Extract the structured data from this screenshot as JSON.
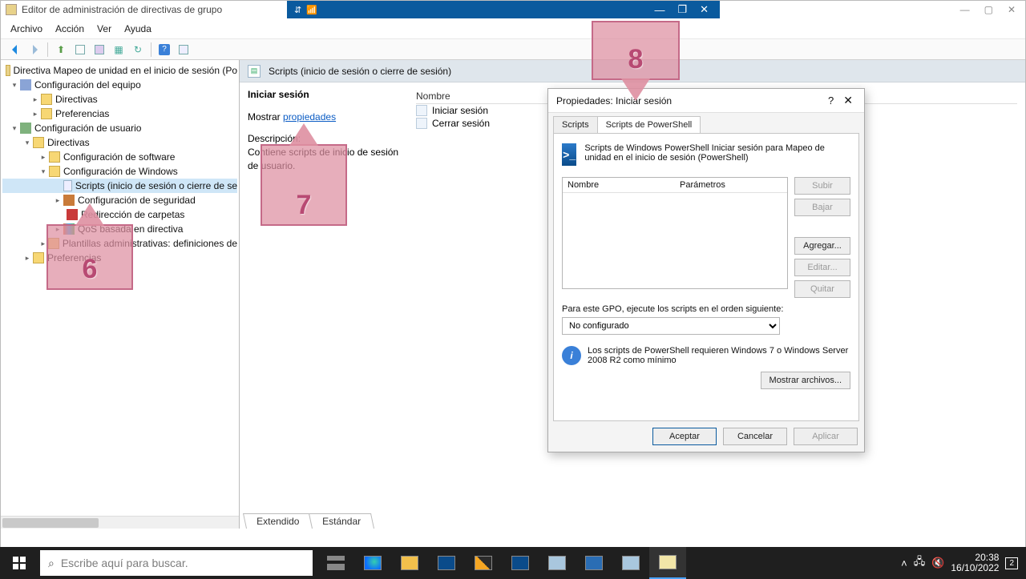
{
  "outer_window": {
    "title": "Editor de administración de directivas de grupo",
    "controls": {
      "minimize": "—",
      "maximize": "▢",
      "close": "✕"
    }
  },
  "vm_bar": {
    "pin_icon": "pin-icon",
    "signal_icon": "signal-icon",
    "minimize": "—",
    "restore": "❐",
    "close": "✕"
  },
  "menubar": [
    "Archivo",
    "Acción",
    "Ver",
    "Ayuda"
  ],
  "toolbar": {
    "back": "back-arrow-icon",
    "forward": "forward-arrow-icon",
    "up": "up-folder-icon",
    "icons": [
      "list-icon",
      "grid-icon",
      "export-icon",
      "refresh-icon",
      "help-icon",
      "props-icon"
    ]
  },
  "tree": {
    "root": "Directiva Mapeo de unidad en el inicio de sesión (Po",
    "computer": {
      "label": "Configuración del equipo",
      "children": [
        "Directivas",
        "Preferencias"
      ]
    },
    "user": {
      "label": "Configuración de usuario",
      "directivas": "Directivas",
      "subchildren": {
        "software": "Configuración de software",
        "windows": "Configuración de Windows",
        "windows_children": {
          "scripts": "Scripts (inicio de sesión o cierre de se",
          "security": "Configuración de seguridad",
          "folder_redir": "Redirección de carpetas",
          "qos": "QoS basada en directiva"
        },
        "templates": "Plantillas administrativas: definiciones de"
      },
      "preferencias": "Preferencias"
    }
  },
  "details": {
    "header": "Scripts (inicio de sesión o cierre de sesión)",
    "left": {
      "heading": "Iniciar sesión",
      "show_prefix": "Mostrar ",
      "show_link": "propiedades",
      "desc_label": "Descripción:",
      "desc_text": "Contiene scripts de inicio de sesión de usuario."
    },
    "right": {
      "col_header": "Nombre",
      "items": [
        "Iniciar sesión",
        "Cerrar sesión"
      ]
    },
    "tabs": [
      "Extendido",
      "Estándar"
    ]
  },
  "dialog": {
    "title": "Propiedades: Iniciar sesión",
    "help": "?",
    "close": "✕",
    "tabs": {
      "scripts": "Scripts",
      "powershell": "Scripts de PowerShell"
    },
    "ps_text": "Scripts de Windows PowerShell Iniciar sesión para Mapeo de unidad en el inicio de sesión (PowerShell)",
    "cols": {
      "name": "Nombre",
      "params": "Parámetros"
    },
    "buttons": {
      "up": "Subir",
      "down": "Bajar",
      "add": "Agregar...",
      "edit": "Editar...",
      "remove": "Quitar"
    },
    "order_label": "Para este GPO, ejecute los scripts en el orden siguiente:",
    "order_value": "No configurado",
    "info": "Los scripts de PowerShell requieren Windows 7 o Windows Server 2008 R2 como mínimo",
    "show_files": "Mostrar archivos...",
    "footer": {
      "accept": "Aceptar",
      "cancel": "Cancelar",
      "apply": "Aplicar"
    }
  },
  "callouts": {
    "c6": "6",
    "c7": "7",
    "c8": "8"
  },
  "taskbar": {
    "search_placeholder": "Escribe aquí para buscar.",
    "clock_time": "20:38",
    "clock_date": "16/10/2022",
    "notif_count": "2"
  }
}
